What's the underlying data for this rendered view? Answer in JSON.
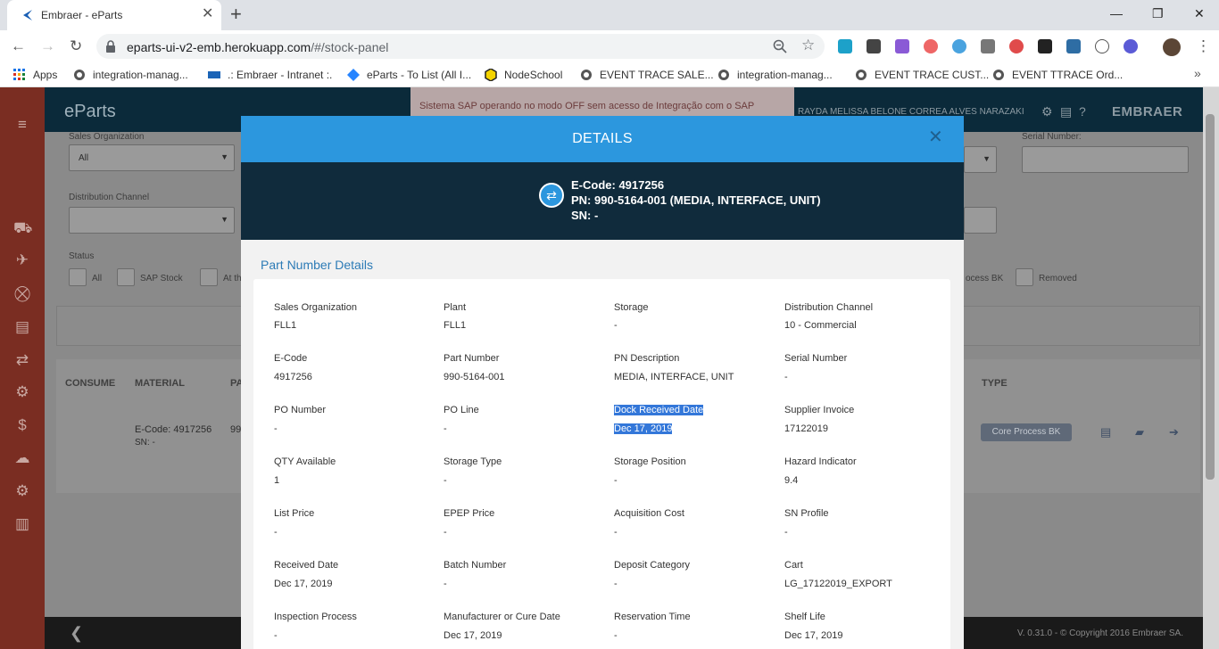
{
  "browser": {
    "tab_title": "Embraer - eParts",
    "url_host": "eparts-ui-v2-emb.herokuapp.com",
    "url_path": "/#/stock-panel",
    "bookmarks": [
      {
        "label": "Apps"
      },
      {
        "label": "integration-manag..."
      },
      {
        "label": ".: Embraer - Intranet :."
      },
      {
        "label": "eParts - To List (All I..."
      },
      {
        "label": "NodeSchool"
      },
      {
        "label": "EVENT TRACE SALE..."
      },
      {
        "label": "integration-manag..."
      },
      {
        "label": "EVENT TRACE CUST..."
      },
      {
        "label": "EVENT TTRACE Ord..."
      }
    ]
  },
  "app": {
    "brand": "eParts",
    "sap_warning": "Sistema SAP operando no modo OFF sem acesso de Integração com o SAP",
    "user_name": "RAYDA MELISSA BELONE CORREA ALVES NARAZAKI",
    "logo_text": "EMBRAER",
    "filters": {
      "sales_org_label": "Sales Organization",
      "sales_org_value": "All",
      "dist_channel_label": "Distribution Channel",
      "dist_channel_value": "",
      "status_label": "Status",
      "serial_label": "Serial Number:",
      "status_options": [
        "All",
        "SAP Stock",
        "At th",
        "ocess BK",
        "Removed"
      ]
    },
    "table": {
      "headers": [
        "CONSUME",
        "MATERIAL",
        "PA",
        "TYPE"
      ],
      "row": {
        "ecode": "E-Code: 4917256",
        "sn": "SN: -",
        "pn_partial": "99",
        "type_badge": "Core Process BK"
      }
    },
    "footer_copyright": "V. 0.31.0 - © Copyright 2016 Embraer SA."
  },
  "modal": {
    "title": "DETAILS",
    "header_ecode": "E-Code: 4917256",
    "header_pn": "PN: 990-5164-001 (MEDIA, INTERFACE, UNIT)",
    "header_sn": "SN: -",
    "section_title": "Part Number Details",
    "fields": [
      {
        "label": "Sales Organization",
        "value": "FLL1"
      },
      {
        "label": "Plant",
        "value": "FLL1"
      },
      {
        "label": "Storage",
        "value": "-"
      },
      {
        "label": "Distribution Channel",
        "value": "10 - Commercial"
      },
      {
        "label": "E-Code",
        "value": "4917256"
      },
      {
        "label": "Part Number",
        "value": "990-5164-001"
      },
      {
        "label": "PN Description",
        "value": "MEDIA, INTERFACE, UNIT"
      },
      {
        "label": "Serial Number",
        "value": "-"
      },
      {
        "label": "PO Number",
        "value": "-"
      },
      {
        "label": "PO Line",
        "value": "-"
      },
      {
        "label": "Dock Received Date",
        "value": "Dec 17, 2019"
      },
      {
        "label": "Supplier Invoice",
        "value": "17122019"
      },
      {
        "label": "QTY Available",
        "value": "1"
      },
      {
        "label": "Storage Type",
        "value": "-"
      },
      {
        "label": "Storage Position",
        "value": "-"
      },
      {
        "label": "Hazard Indicator",
        "value": "9.4"
      },
      {
        "label": "List Price",
        "value": "-"
      },
      {
        "label": "EPEP Price",
        "value": "-"
      },
      {
        "label": "Acquisition Cost",
        "value": "-"
      },
      {
        "label": "SN Profile",
        "value": "-"
      },
      {
        "label": "Received Date",
        "value": "Dec 17, 2019"
      },
      {
        "label": "Batch Number",
        "value": "-"
      },
      {
        "label": "Deposit Category",
        "value": "-"
      },
      {
        "label": "Cart",
        "value": "LG_17122019_EXPORT"
      },
      {
        "label": "Inspection Process",
        "value": "-"
      },
      {
        "label": "Manufacturer or Cure Date",
        "value": "Dec 17, 2019"
      },
      {
        "label": "Reservation Time",
        "value": "-"
      },
      {
        "label": "Shelf Life",
        "value": "Dec 17, 2019"
      }
    ]
  },
  "colors": {
    "modal_header": "#2c97de",
    "modal_band": "#102b3c",
    "section_title": "#2c7bb6",
    "selection": "#3377d9",
    "sidebar": "#7a2d22"
  }
}
